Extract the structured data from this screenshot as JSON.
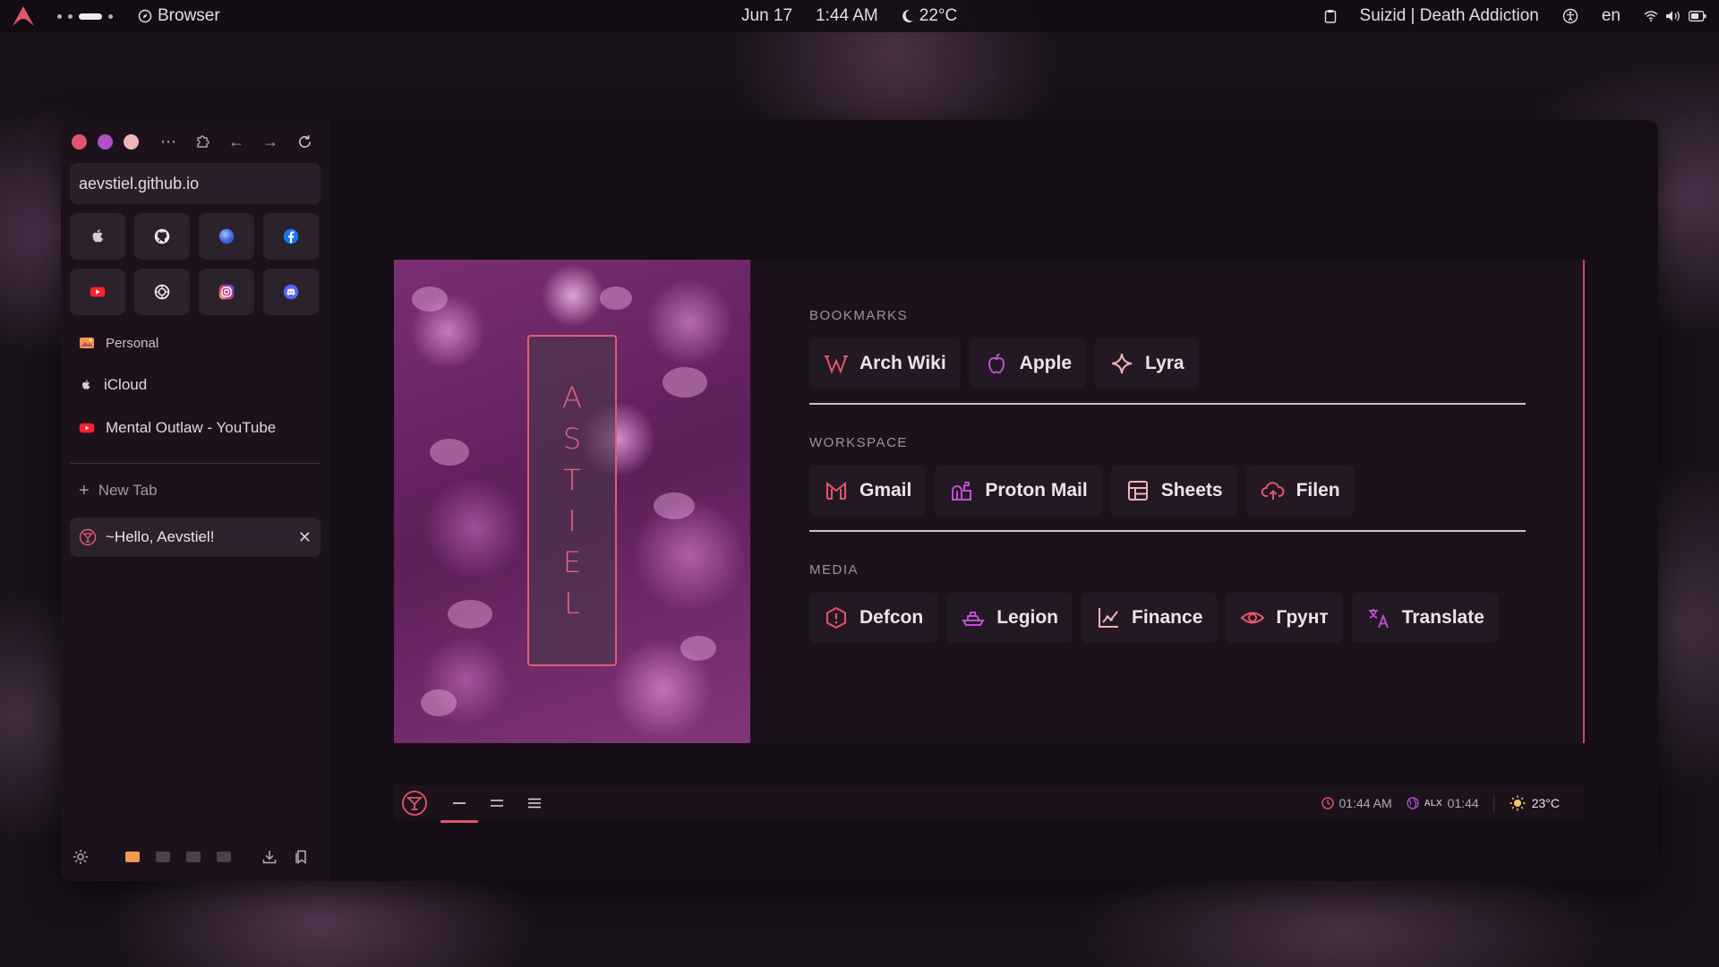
{
  "topbar": {
    "app_name": "Browser",
    "date": "Jun 17",
    "time": "1:44 AM",
    "weather": "22°C",
    "media": "Suizid | Death Addiction",
    "language": "en"
  },
  "browser": {
    "url": "aevstiel.github.io",
    "pinned_sites": [
      {
        "name": "apple-icon"
      },
      {
        "name": "github-icon"
      },
      {
        "name": "globe-icon"
      },
      {
        "name": "facebook-icon"
      },
      {
        "name": "youtube-icon"
      },
      {
        "name": "chatgpt-icon"
      },
      {
        "name": "instagram-icon"
      },
      {
        "name": "discord-icon"
      }
    ],
    "folder_label": "Personal",
    "tabs": [
      {
        "label": "iCloud"
      },
      {
        "label": "Mental Outlaw - YouTube"
      }
    ],
    "new_tab_label": "New Tab",
    "active_tab_label": "~Hello, Aevstiel!"
  },
  "page": {
    "name_letters": [
      "A",
      "S",
      "T",
      "I",
      "E",
      "L"
    ],
    "sections": [
      {
        "title": "BOOKMARKS",
        "links": [
          {
            "label": "Arch Wiki",
            "icon": "wikipedia-icon"
          },
          {
            "label": "Apple",
            "icon": "apple-icon"
          },
          {
            "label": "Lyra",
            "icon": "sparkle-icon"
          }
        ]
      },
      {
        "title": "WORKSPACE",
        "links": [
          {
            "label": "Gmail",
            "icon": "gmail-icon"
          },
          {
            "label": "Proton Mail",
            "icon": "mailbox-icon"
          },
          {
            "label": "Sheets",
            "icon": "table-icon"
          },
          {
            "label": "Filen",
            "icon": "cloud-upload-icon"
          }
        ]
      },
      {
        "title": "MEDIA",
        "links": [
          {
            "label": "Defcon",
            "icon": "alert-hexagon-icon"
          },
          {
            "label": "Legion",
            "icon": "ship-icon"
          },
          {
            "label": "Finance",
            "icon": "chart-icon"
          },
          {
            "label": "Грунт",
            "icon": "eye-icon"
          },
          {
            "label": "Translate",
            "icon": "translate-icon"
          }
        ]
      }
    ],
    "status": {
      "local_time": "01:44 AM",
      "zone_label": "ALX",
      "zone_time": "01:44",
      "temperature": "23°C"
    }
  },
  "colors": {
    "accent_red": "#e2566c",
    "accent_pink": "#e86181",
    "accent_purple": "#b051c9",
    "window_bg": "#140c15"
  }
}
